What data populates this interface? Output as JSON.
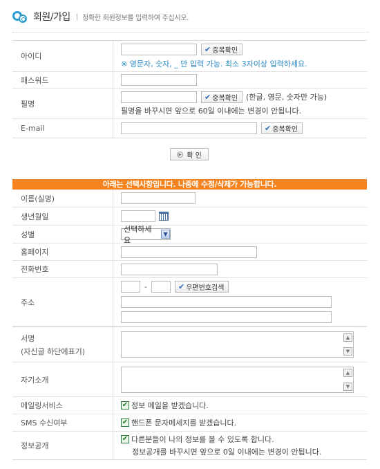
{
  "header": {
    "title": "회원/가입",
    "separator": "|",
    "description": "정확한 회원정보를 입력하여 주십시오."
  },
  "required": {
    "id": {
      "label": "아이디",
      "check_button": "중복확인",
      "hint": "※ 영문자, 숫자, _ 만 입력 가능. 최소 3자이상 입력하세요."
    },
    "password": {
      "label": "패스워드"
    },
    "nickname": {
      "label": "필명",
      "check_button": "중복확인",
      "note": "(한글, 영문, 숫자만 가능)",
      "notice": "필명을 바꾸시면 앞으로 60일 이내에는 변경이 안됩니다."
    },
    "email": {
      "label": "E-mail",
      "check_button": "중복확인"
    }
  },
  "confirm_button": "확 인",
  "optional_banner": "아래는 선택사항입니다. 나중에 수정/삭제가 가능합니다.",
  "optional": {
    "name": {
      "label": "이름(실명)"
    },
    "birthday": {
      "label": "생년월일"
    },
    "gender": {
      "label": "성별",
      "selected": "선택하세요"
    },
    "homepage": {
      "label": "홈페이지"
    },
    "phone": {
      "label": "전화번호"
    },
    "address": {
      "label": "주소",
      "dash": "-",
      "zip_button": "우편번호검색"
    },
    "signature": {
      "label": "서명",
      "sublabel": "(자신글 하단에표기)"
    },
    "intro": {
      "label": "자기소개"
    },
    "mailing": {
      "label": "메일링서비스",
      "text": "정보 메일을 받겠습니다."
    },
    "sms": {
      "label": "SMS 수신여부",
      "text": "핸드폰 문자메세지를 받겠습니다."
    },
    "disclosure": {
      "label": "정보공개",
      "text": "다른분들이 나의 정보를 볼 수 있도록 합니다.",
      "notice": "정보공개를 바꾸시면 앞으로 0일 이내에는 변경이 안됩니다."
    }
  }
}
